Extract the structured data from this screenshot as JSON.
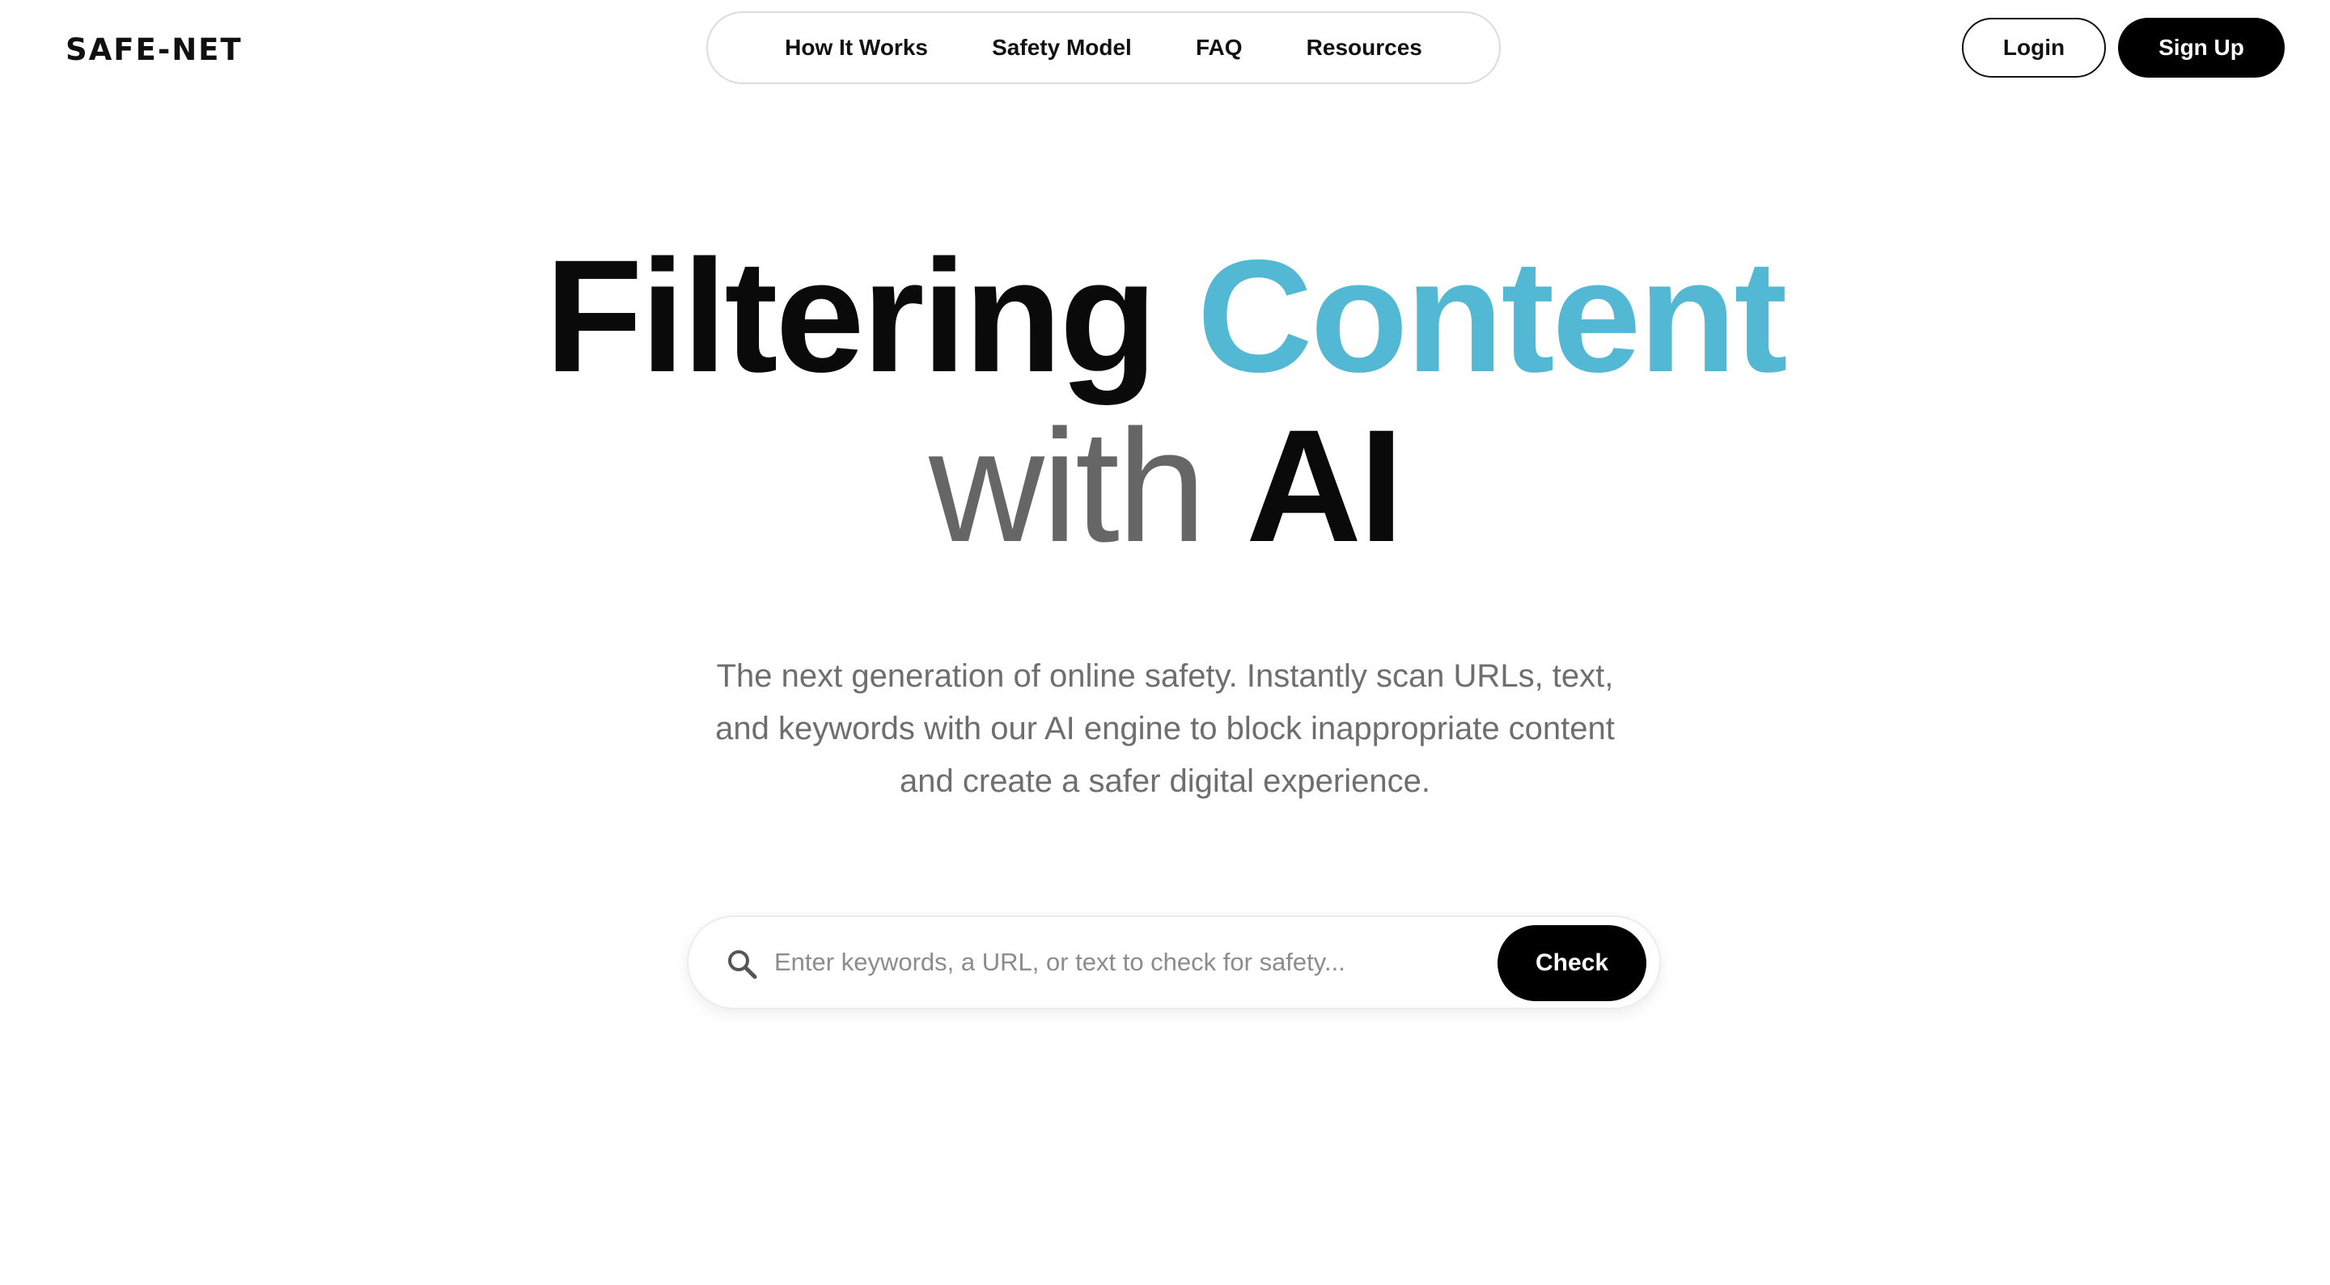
{
  "brand": {
    "name": "SAFE-NET"
  },
  "nav": {
    "links": [
      {
        "label": "How It Works"
      },
      {
        "label": "Safety Model"
      },
      {
        "label": "FAQ"
      },
      {
        "label": "Resources"
      }
    ]
  },
  "auth": {
    "login_label": "Login",
    "signup_label": "Sign Up"
  },
  "hero": {
    "title_word_1": "Filtering",
    "title_word_2": "Content",
    "title_word_3": "with",
    "title_word_4": "AI",
    "subtitle_line_1": "The next generation of online safety. Instantly scan URLs, text,",
    "subtitle_line_2": "and keywords with our AI engine to block inappropriate content",
    "subtitle_line_3": "and create a safer digital experience."
  },
  "search": {
    "icon": "search-icon",
    "value": "",
    "placeholder": "Enter keywords, a URL, or text to check for safety...",
    "button_label": "Check"
  },
  "colors": {
    "accent": "#52b8d3",
    "primary": "#000000",
    "muted_text": "#6e6e6e",
    "background": "#ffffff"
  }
}
